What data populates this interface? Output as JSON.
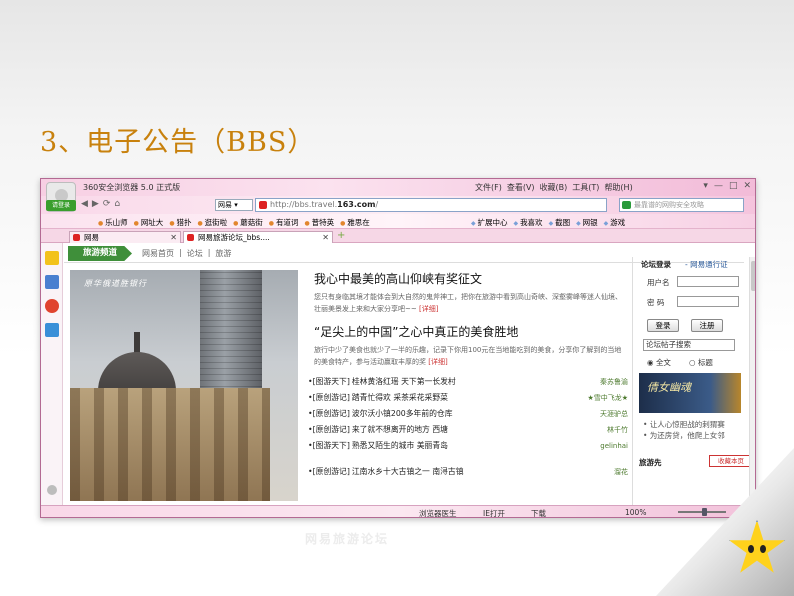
{
  "slide": {
    "title": "3、电子公告（BBS）"
  },
  "browser": {
    "app_name": "360安全浏览器 5.0 正式版",
    "login_label": "请登录",
    "menu": [
      "文件(F)",
      "查看(V)",
      "收藏(B)",
      "工具(T)",
      "帮助(H)"
    ],
    "win_controls": [
      "▾",
      "—",
      "□",
      "✕"
    ],
    "nav_buttons": [
      "◀",
      "▶",
      "⟳",
      "⌂"
    ],
    "engine": "网易 ▾",
    "url": {
      "prefix": "http://bbs.travel.",
      "bold": "163.com",
      "suffix": "/"
    },
    "search_placeholder": "最靠谱的网购安全攻略",
    "favorites_left": [
      "乐山师",
      "网址大",
      "猎扑",
      "逛街啦",
      "蘑菇街",
      "有道词",
      "普特英",
      "雅思在"
    ],
    "favorites_right": [
      "扩展中心",
      "我喜欢",
      "截图",
      "网银",
      "游戏"
    ],
    "tabs": [
      {
        "label": "网易",
        "close": "✕"
      },
      {
        "label": "网易旅游论坛_bbs....",
        "close": "✕"
      }
    ],
    "tab_add": "+",
    "status": {
      "doctor": "浏览器医生",
      "ie_open": "IE打开",
      "download": "下载",
      "zoom": "100%"
    }
  },
  "page": {
    "channel_tag": "旅游频道",
    "breadcrumbs": [
      "网易首页",
      "论坛",
      "旅游"
    ],
    "photo_caption": "原华俄道胜银行",
    "feature1": {
      "headline": "我心中最美的高山仰峡有奖征文",
      "summary": "您只有身临其境才能体会到大自然的鬼斧神工，把你在旅游中看到高山奇峡、深壑雾峰等迷人仙境、壮丽美景发上来和大家分享吧~~",
      "detail": "[详细]"
    },
    "feature2": {
      "headline": "“足尖上的中国”之心中真正的美食胜地",
      "summary": "旅行中少了美食也就少了一半的乐趣，记录下你用100元在当地能吃到的美食，分享你了解到的当地的美食特产，参与活动赢取丰厚的奖",
      "detail": "[详细]"
    },
    "threads": [
      {
        "cat": "•[图游天下]",
        "title": "桂林黄洛红瑶  天下第一长发村",
        "author": "秦苏鲁渝"
      },
      {
        "cat": "•[原创游记]",
        "title": "踏青忙得欢  采茶采花采野菜",
        "author": "★雪中飞龙★"
      },
      {
        "cat": "•[原创游记]",
        "title": "波尔沃小镇200多年前的仓库",
        "author": "天涯驴总"
      },
      {
        "cat": "•[原创游记]",
        "title": "来了就不想离开的地方  西塘",
        "author": "林千竹"
      },
      {
        "cat": "•[图游天下]",
        "title": "熟悉又陌生的城市  美丽青岛",
        "author": "gelinhai"
      },
      {
        "cat": "•[原创游记]",
        "title": "江南水乡十大古镇之一  南浔古镇",
        "author": "溜花"
      }
    ],
    "login_panel": {
      "title": "论坛登录",
      "pass_link": "- 网易通行证",
      "username_label": "用户名",
      "password_label": "密  码",
      "login_button": "登录",
      "register_button": "注册",
      "search_value": "论坛帖子搜索",
      "radio_full": "全文",
      "radio_title": "标题",
      "banner_text": "倩女幽魂",
      "links": [
        "• 让人心惊胆战的刺猬赛",
        "• 为还房贷，他爬上女邻"
      ],
      "travel_title": "旅游先",
      "fav_badge": "收藏本页"
    }
  },
  "watermark": "网易旅游论坛",
  "colors": {
    "title": "#c8810d",
    "chrome_pink": "#f7cfe3",
    "channel_green": "#3f8f3a",
    "detail_red": "#cc3333"
  }
}
